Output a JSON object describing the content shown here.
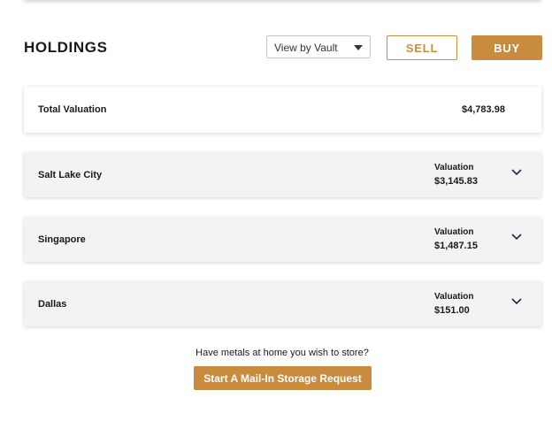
{
  "holdings": {
    "title": "HOLDINGS",
    "view_select": {
      "selected": "View by Vault"
    },
    "sell_label": "SELL",
    "buy_label": "BUY"
  },
  "total": {
    "label": "Total Valuation",
    "value": "$4,783.98"
  },
  "vaults": [
    {
      "name": "Salt Lake City",
      "valuation_label": "Valuation",
      "valuation": "$3,145.83"
    },
    {
      "name": "Singapore",
      "valuation_label": "Valuation",
      "valuation": "$1,487.15"
    },
    {
      "name": "Dallas",
      "valuation_label": "Valuation",
      "valuation": "$151.00"
    }
  ],
  "mail_in": {
    "prompt": "Have metals at home you wish to store?",
    "button_label": "Start A Mail-In Storage Request"
  },
  "colors": {
    "accent": "#c98b3e",
    "card_background": "#f3f3f3"
  },
  "icons": {
    "select_caret": "caret-down-icon",
    "expand": "chevron-down-icon"
  }
}
